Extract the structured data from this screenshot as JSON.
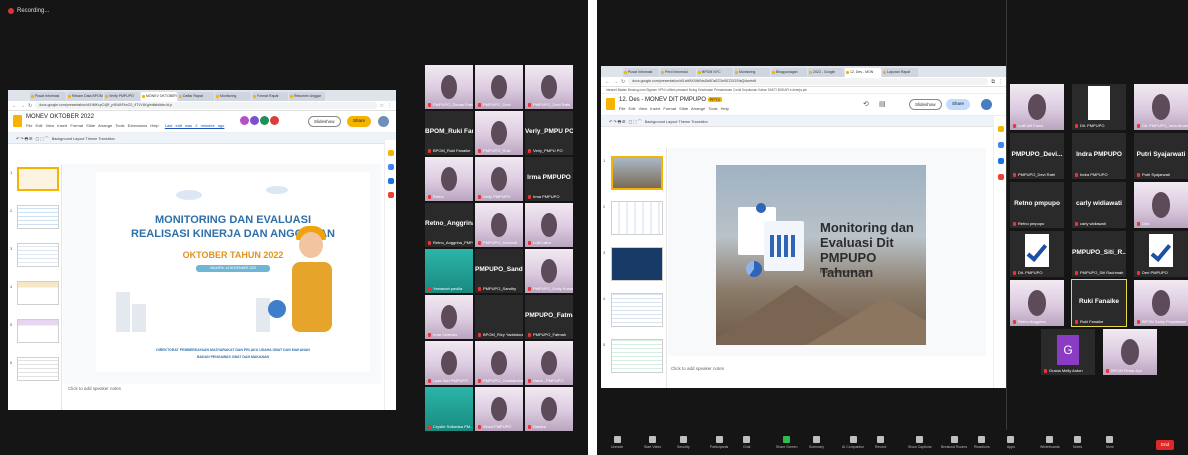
{
  "left_panel": {
    "recording_label": "Recording...",
    "browser": {
      "tabs": [
        "Pusat Informasi",
        "Rekam Data BPOM",
        "Verify PMPUPO",
        "MONEV OKTOBER",
        "Daftar Rapat",
        "Monitoring",
        "Format Rapat",
        "Rekomen Anggar"
      ],
      "url": "docs.google.com/presentation/d/1fMKcpC4jR_p9IWAFbcO2_9T1V4Kg/edit#slide=id.p",
      "doc_title": "MONEV OKTOBER 2022",
      "menu": "File Edit View Insert Format Slide Arrange Tools Extensions Help",
      "last_edit": "Last edit was 2 minutes ago",
      "slideshow_label": "Slideshow",
      "share_label": "Share",
      "toolbar": "Background  Layout  Theme  Transition",
      "notes": "Click to add speaker notes",
      "slide": {
        "title_line1": "MONITORING DAN EVALUASI",
        "title_line2": "REALISASI KINERJA DAN ANGGARAN",
        "period": "OKTOBER TAHUN 2022",
        "date_badge": "JAKARTA, 14 NOVEMBER 2022",
        "footer_line1": "DIREKTORAT PEMBERDAYAAN MASYARAKAT DAN PELAKU USAHA OBAT DAN MAKANAN",
        "footer_line2": "BADAN PENGAWAS OBAT DAN MAKANAN"
      }
    },
    "participants": [
      {
        "name": "PMPUPO_Dimas Putra A",
        "big": ""
      },
      {
        "name": "PMPUPO_Devi",
        "big": ""
      },
      {
        "name": "PMPUPO_Devi Ratri",
        "big": ""
      },
      {
        "name": "BPOM_Ruki Fanaike",
        "big": "BPOM_Ruki Fan..."
      },
      {
        "name": "PMPUPO_Ruki",
        "big": ""
      },
      {
        "name": "Verly_PMPU PO",
        "big": "Verly_PMPU PO"
      },
      {
        "name": "Retno",
        "big": ""
      },
      {
        "name": "Verly PMPUPO",
        "big": ""
      },
      {
        "name": "Irma PMPUPO",
        "big": "Irma PMPUPO"
      },
      {
        "name": "Retno_Anggrina_PMP...",
        "big": "Retno_Anggrina..."
      },
      {
        "name": "PMPUPO_Muhardi",
        "big": ""
      },
      {
        "name": "Lutfi Latra",
        "big": ""
      },
      {
        "name": "Yamanah pavilia",
        "big": ""
      },
      {
        "name": "PMPUPO_Sandhy",
        "big": "PMPUPO_Sandhy"
      },
      {
        "name": "PMPUPO_Eddy Kubang",
        "big": ""
      },
      {
        "name": "Irma Sinensis",
        "big": ""
      },
      {
        "name": "BPOM_Rizy Yaddokuss",
        "big": ""
      },
      {
        "name": "PMPUPO_Fatmah",
        "big": "PMPUPO_Fatmah"
      },
      {
        "name": "Lyda Sari PMPUPO",
        "big": ""
      },
      {
        "name": "PMPUPO_Gushabrina",
        "big": ""
      },
      {
        "name": "Nana - PMPUPO",
        "big": ""
      },
      {
        "name": "Crystle Sofianisa PM...",
        "big": ""
      },
      {
        "name": "Vinca PMPUPO",
        "big": ""
      },
      {
        "name": "Sandra",
        "big": ""
      }
    ]
  },
  "right_panel": {
    "browser": {
      "tabs": [
        "Pusat Informasi",
        "Perd Informasi",
        "BPOM NYC",
        "Monitoring",
        "Bhagyanagan",
        "2022 - Google",
        "12. Des - MON",
        "Laporan Rapat"
      ],
      "url": "docs.google.com/presentation/d/1aHBX0W0dsDb8DsEZ3cf9ZZGOSfaQidw/edit",
      "bookmarks": "Intranet Badan  Brosing.com  Sigmen VPN  LetNes peasant  Nolog Kesehatan  Pemantauan Covid  Keputusan Kabar  SAKTI  BOKAR  e-kinerja.pln",
      "doc_title": "12. Des - MONEV DIT PMPUPO",
      "doc_badge": "PPTX",
      "menu": "File Edit View Insert Format Slide Arrange Tools Help",
      "slideshow_label": "Slideshow",
      "share_label": "Share",
      "toolbar": "Background  Layout  Theme  Transition",
      "notes": "Click to add speaker notes",
      "slide": {
        "title": "Monitoring dan Evaluasi Dit PMPUPO Tahunan",
        "date": "Rabu, 8 Desember 2019"
      }
    },
    "participants": [
      {
        "name": "Lutfi Alif Fauzi",
        "big": ""
      },
      {
        "name": "Dit. PMPUPO",
        "big": ""
      },
      {
        "name": "Dit. PMPUPO_Irma Amanda",
        "big": ""
      },
      {
        "name": "PMPUPO_Devi Ratri",
        "big": "PMPUPO_Devi..."
      },
      {
        "name": "Indra PMPUPO",
        "big": "Indra PMPUPO"
      },
      {
        "name": "Putri Syajarwati",
        "big": "Putri Syajarwati"
      },
      {
        "name": "Retno pmpupo",
        "big": "Retno pmpupo"
      },
      {
        "name": "carly widiawati",
        "big": "carly widiawati"
      },
      {
        "name": "Dila",
        "big": ""
      },
      {
        "name": "Dit. PMPUPO",
        "big": ""
      },
      {
        "name": "PMPUPO_Siti Rachmah",
        "big": "PMPUPO_Siti_R..."
      },
      {
        "name": "Deri PMPUPO",
        "big": ""
      },
      {
        "name": "Retno Anggrina",
        "big": ""
      },
      {
        "name": "Ruki Fanaike",
        "big": "Ruki Fanaike"
      },
      {
        "name": "BPOM Sanly Puspitasari",
        "big": ""
      },
      {
        "name": "Gracia Melly Anton",
        "big": ""
      },
      {
        "name": "BPOM Pintar Ayu",
        "big": ""
      }
    ],
    "controls": [
      "Unmute",
      "Start Video",
      "Security",
      "Participants",
      "Chat",
      "Share Screen",
      "Summary",
      "AI Companion",
      "Record",
      "Show Captions",
      "Breakout Rooms",
      "Reactions",
      "Apps",
      "Whiteboards",
      "Notes",
      "More"
    ],
    "end_label": "End",
    "participants_count": "17"
  }
}
